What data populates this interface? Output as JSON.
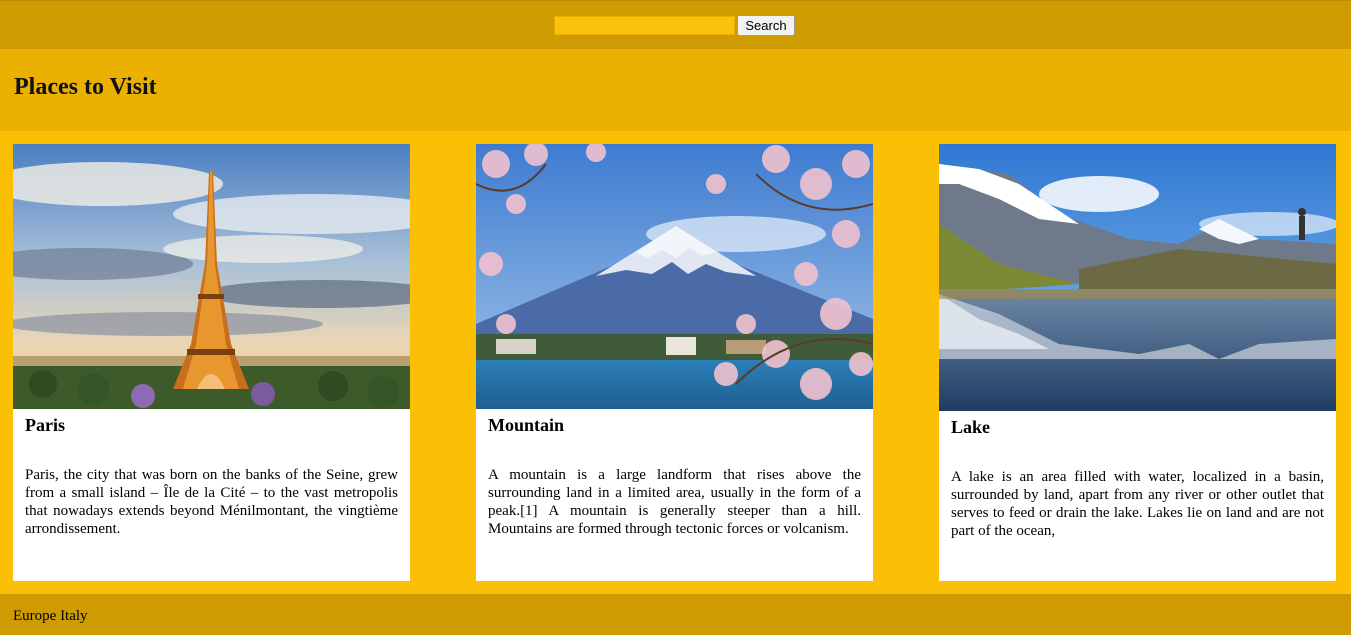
{
  "search": {
    "value": "",
    "placeholder": "",
    "button_label": "Search"
  },
  "header": {
    "title": "Places to Visit"
  },
  "cards": [
    {
      "title": "Paris",
      "text": "Paris, the city that was born on the banks of the Seine, grew from a small island – Île de la Cité – to the vast metropolis that nowadays extends beyond Ménilmontant, the vingtième arrondissement."
    },
    {
      "title": "Mountain",
      "text": "A mountain is a large landform that rises above the surrounding land in a limited area, usually in the form of a peak.[1] A mountain is generally steeper than a hill. Mountains are formed through tectonic forces or volcanism."
    },
    {
      "title": "Lake",
      "text": "A lake is an area filled with water, localized in a basin, surrounded by land, apart from any river or other outlet that serves to feed or drain the lake. Lakes lie on land and are not part of the ocean,"
    }
  ],
  "footer": {
    "text": "Europe Italy"
  },
  "colors": {
    "topbar": "#cf9b02",
    "header": "#ebb102",
    "page": "#fbbf06",
    "footer": "#cf9b02"
  }
}
